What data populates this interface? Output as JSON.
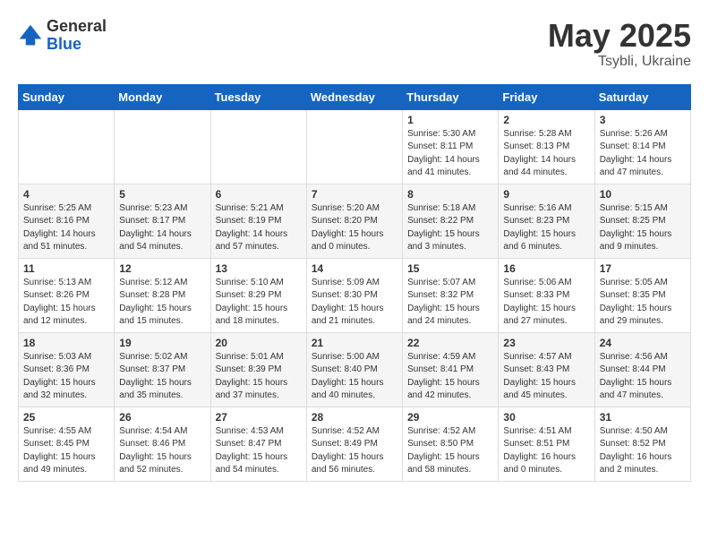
{
  "header": {
    "logo_general": "General",
    "logo_blue": "Blue",
    "title": "May 2025",
    "location": "Tsybli, Ukraine"
  },
  "days_of_week": [
    "Sunday",
    "Monday",
    "Tuesday",
    "Wednesday",
    "Thursday",
    "Friday",
    "Saturday"
  ],
  "rows": [
    [
      {
        "day": "",
        "info": ""
      },
      {
        "day": "",
        "info": ""
      },
      {
        "day": "",
        "info": ""
      },
      {
        "day": "",
        "info": ""
      },
      {
        "day": "1",
        "info": "Sunrise: 5:30 AM\nSunset: 8:11 PM\nDaylight: 14 hours\nand 41 minutes."
      },
      {
        "day": "2",
        "info": "Sunrise: 5:28 AM\nSunset: 8:13 PM\nDaylight: 14 hours\nand 44 minutes."
      },
      {
        "day": "3",
        "info": "Sunrise: 5:26 AM\nSunset: 8:14 PM\nDaylight: 14 hours\nand 47 minutes."
      }
    ],
    [
      {
        "day": "4",
        "info": "Sunrise: 5:25 AM\nSunset: 8:16 PM\nDaylight: 14 hours\nand 51 minutes."
      },
      {
        "day": "5",
        "info": "Sunrise: 5:23 AM\nSunset: 8:17 PM\nDaylight: 14 hours\nand 54 minutes."
      },
      {
        "day": "6",
        "info": "Sunrise: 5:21 AM\nSunset: 8:19 PM\nDaylight: 14 hours\nand 57 minutes."
      },
      {
        "day": "7",
        "info": "Sunrise: 5:20 AM\nSunset: 8:20 PM\nDaylight: 15 hours\nand 0 minutes."
      },
      {
        "day": "8",
        "info": "Sunrise: 5:18 AM\nSunset: 8:22 PM\nDaylight: 15 hours\nand 3 minutes."
      },
      {
        "day": "9",
        "info": "Sunrise: 5:16 AM\nSunset: 8:23 PM\nDaylight: 15 hours\nand 6 minutes."
      },
      {
        "day": "10",
        "info": "Sunrise: 5:15 AM\nSunset: 8:25 PM\nDaylight: 15 hours\nand 9 minutes."
      }
    ],
    [
      {
        "day": "11",
        "info": "Sunrise: 5:13 AM\nSunset: 8:26 PM\nDaylight: 15 hours\nand 12 minutes."
      },
      {
        "day": "12",
        "info": "Sunrise: 5:12 AM\nSunset: 8:28 PM\nDaylight: 15 hours\nand 15 minutes."
      },
      {
        "day": "13",
        "info": "Sunrise: 5:10 AM\nSunset: 8:29 PM\nDaylight: 15 hours\nand 18 minutes."
      },
      {
        "day": "14",
        "info": "Sunrise: 5:09 AM\nSunset: 8:30 PM\nDaylight: 15 hours\nand 21 minutes."
      },
      {
        "day": "15",
        "info": "Sunrise: 5:07 AM\nSunset: 8:32 PM\nDaylight: 15 hours\nand 24 minutes."
      },
      {
        "day": "16",
        "info": "Sunrise: 5:06 AM\nSunset: 8:33 PM\nDaylight: 15 hours\nand 27 minutes."
      },
      {
        "day": "17",
        "info": "Sunrise: 5:05 AM\nSunset: 8:35 PM\nDaylight: 15 hours\nand 29 minutes."
      }
    ],
    [
      {
        "day": "18",
        "info": "Sunrise: 5:03 AM\nSunset: 8:36 PM\nDaylight: 15 hours\nand 32 minutes."
      },
      {
        "day": "19",
        "info": "Sunrise: 5:02 AM\nSunset: 8:37 PM\nDaylight: 15 hours\nand 35 minutes."
      },
      {
        "day": "20",
        "info": "Sunrise: 5:01 AM\nSunset: 8:39 PM\nDaylight: 15 hours\nand 37 minutes."
      },
      {
        "day": "21",
        "info": "Sunrise: 5:00 AM\nSunset: 8:40 PM\nDaylight: 15 hours\nand 40 minutes."
      },
      {
        "day": "22",
        "info": "Sunrise: 4:59 AM\nSunset: 8:41 PM\nDaylight: 15 hours\nand 42 minutes."
      },
      {
        "day": "23",
        "info": "Sunrise: 4:57 AM\nSunset: 8:43 PM\nDaylight: 15 hours\nand 45 minutes."
      },
      {
        "day": "24",
        "info": "Sunrise: 4:56 AM\nSunset: 8:44 PM\nDaylight: 15 hours\nand 47 minutes."
      }
    ],
    [
      {
        "day": "25",
        "info": "Sunrise: 4:55 AM\nSunset: 8:45 PM\nDaylight: 15 hours\nand 49 minutes."
      },
      {
        "day": "26",
        "info": "Sunrise: 4:54 AM\nSunset: 8:46 PM\nDaylight: 15 hours\nand 52 minutes."
      },
      {
        "day": "27",
        "info": "Sunrise: 4:53 AM\nSunset: 8:47 PM\nDaylight: 15 hours\nand 54 minutes."
      },
      {
        "day": "28",
        "info": "Sunrise: 4:52 AM\nSunset: 8:49 PM\nDaylight: 15 hours\nand 56 minutes."
      },
      {
        "day": "29",
        "info": "Sunrise: 4:52 AM\nSunset: 8:50 PM\nDaylight: 15 hours\nand 58 minutes."
      },
      {
        "day": "30",
        "info": "Sunrise: 4:51 AM\nSunset: 8:51 PM\nDaylight: 16 hours\nand 0 minutes."
      },
      {
        "day": "31",
        "info": "Sunrise: 4:50 AM\nSunset: 8:52 PM\nDaylight: 16 hours\nand 2 minutes."
      }
    ]
  ]
}
